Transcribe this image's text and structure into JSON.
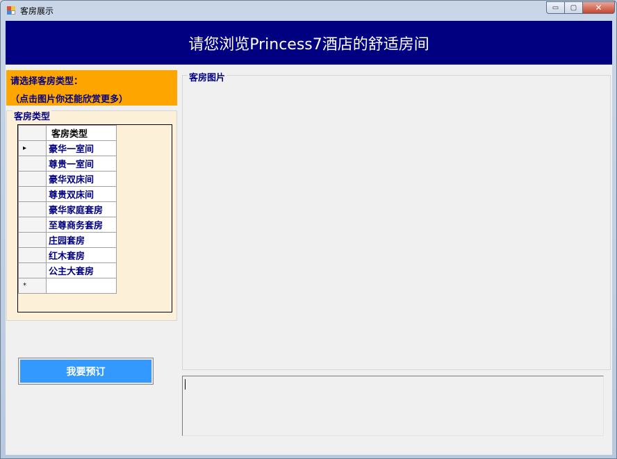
{
  "window": {
    "title": "客房展示",
    "minimize_label": "▭",
    "maximize_label": "▢",
    "close_label": "✕"
  },
  "banner": {
    "text": "请您浏览Princess7酒店的舒适房间"
  },
  "prompt": {
    "line1": "请选择客房类型：",
    "line2": "（点击图片你还能欣赏更多）"
  },
  "room_group": {
    "legend": "客房类型",
    "column_header": "客房类型",
    "current_row_marker": "▸",
    "new_row_marker": "*",
    "rows": [
      "豪华一室间",
      "尊贵一室间",
      "豪华双床间",
      "尊贵双床间",
      "豪华家庭套房",
      "至尊商务套房",
      "庄园套房",
      "红木套房",
      "公主大套房"
    ]
  },
  "book_button": {
    "label": "我要预订"
  },
  "picture_group": {
    "legend": "客房图片"
  },
  "description": {
    "value": ""
  },
  "colors": {
    "banner_bg": "#000080",
    "prompt_bg": "#ffa500",
    "group_bg": "#fdf0d9",
    "button_bg": "#3399ff",
    "text_navy": "#000080"
  }
}
